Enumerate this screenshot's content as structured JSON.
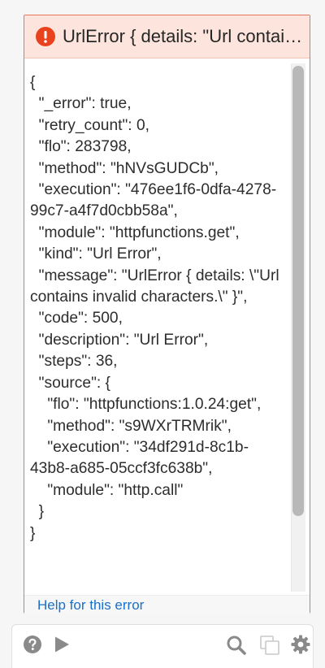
{
  "error": {
    "title": "UrlError { details: \"Url contains invalid characters.\" }",
    "json_text": "{\n  \"_error\": true,\n  \"retry_count\": 0,\n  \"flo\": 283798,\n  \"method\": \"hNVsGUDCb\",\n  \"execution\": \"476ee1f6-0dfa-4278-99c7-a4f7d0cbb58a\",\n  \"module\": \"httpfunctions.get\",\n  \"kind\": \"Url Error\",\n  \"message\": \"UrlError { details: \\\"Url contains invalid characters.\\\" }\",\n  \"code\": 500,\n  \"description\": \"Url Error\",\n  \"steps\": 36,\n  \"source\": {\n    \"flo\": \"httpfunctions:1.0.24:get\",\n    \"method\": \"s9WXrTRMrik\",\n    \"execution\": \"34df291d-8c1b-43b8-a685-05ccf3fc638b\",\n    \"module\": \"http.call\"\n  }\n}",
    "help_link": "Help for this error"
  },
  "icons": {
    "alert": "alert-circle-icon",
    "help": "question-circle-icon",
    "play": "play-icon",
    "search": "search-icon",
    "copy": "copy-icon",
    "settings": "gear-icon"
  },
  "colors": {
    "error_border": "#e8735c",
    "error_header_bg": "#fde5dd",
    "alert_icon": "#e8421e",
    "link": "#1a6fc9"
  }
}
